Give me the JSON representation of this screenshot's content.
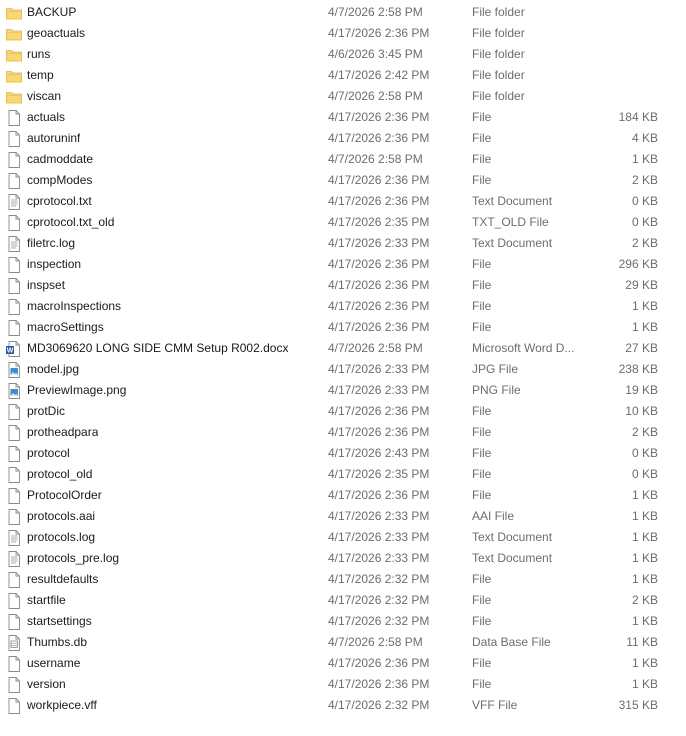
{
  "files": [
    {
      "name": "BACKUP",
      "date": "4/7/2026 2:58 PM",
      "type": "File folder",
      "size": "",
      "icon": "folder-icon"
    },
    {
      "name": "geoactuals",
      "date": "4/17/2026 2:36 PM",
      "type": "File folder",
      "size": "",
      "icon": "folder-icon"
    },
    {
      "name": "runs",
      "date": "4/6/2026 3:45 PM",
      "type": "File folder",
      "size": "",
      "icon": "folder-icon"
    },
    {
      "name": "temp",
      "date": "4/17/2026 2:42 PM",
      "type": "File folder",
      "size": "",
      "icon": "folder-icon"
    },
    {
      "name": "viscan",
      "date": "4/7/2026 2:58 PM",
      "type": "File folder",
      "size": "",
      "icon": "folder-icon"
    },
    {
      "name": "actuals",
      "date": "4/17/2026 2:36 PM",
      "type": "File",
      "size": "184 KB",
      "icon": "file-icon"
    },
    {
      "name": "autoruninf",
      "date": "4/17/2026 2:36 PM",
      "type": "File",
      "size": "4 KB",
      "icon": "file-icon"
    },
    {
      "name": "cadmoddate",
      "date": "4/7/2026 2:58 PM",
      "type": "File",
      "size": "1 KB",
      "icon": "file-icon"
    },
    {
      "name": "compModes",
      "date": "4/17/2026 2:36 PM",
      "type": "File",
      "size": "2 KB",
      "icon": "file-icon"
    },
    {
      "name": "cprotocol.txt",
      "date": "4/17/2026 2:36 PM",
      "type": "Text Document",
      "size": "0 KB",
      "icon": "text-document-icon"
    },
    {
      "name": "cprotocol.txt_old",
      "date": "4/17/2026 2:35 PM",
      "type": "TXT_OLD File",
      "size": "0 KB",
      "icon": "file-icon"
    },
    {
      "name": "filetrc.log",
      "date": "4/17/2026 2:33 PM",
      "type": "Text Document",
      "size": "2 KB",
      "icon": "text-document-icon"
    },
    {
      "name": "inspection",
      "date": "4/17/2026 2:36 PM",
      "type": "File",
      "size": "296 KB",
      "icon": "file-icon"
    },
    {
      "name": "inspset",
      "date": "4/17/2026 2:36 PM",
      "type": "File",
      "size": "29 KB",
      "icon": "file-icon"
    },
    {
      "name": "macroInspections",
      "date": "4/17/2026 2:36 PM",
      "type": "File",
      "size": "1 KB",
      "icon": "file-icon"
    },
    {
      "name": "macroSettings",
      "date": "4/17/2026 2:36 PM",
      "type": "File",
      "size": "1 KB",
      "icon": "file-icon"
    },
    {
      "name": "MD3069620 LONG SIDE CMM Setup R002.docx",
      "date": "4/7/2026 2:58 PM",
      "type": "Microsoft Word D...",
      "size": "27 KB",
      "icon": "word-document-icon"
    },
    {
      "name": "model.jpg",
      "date": "4/17/2026 2:33 PM",
      "type": "JPG File",
      "size": "238 KB",
      "icon": "image-file-icon"
    },
    {
      "name": "PreviewImage.png",
      "date": "4/17/2026 2:33 PM",
      "type": "PNG File",
      "size": "19 KB",
      "icon": "image-file-icon"
    },
    {
      "name": "protDic",
      "date": "4/17/2026 2:36 PM",
      "type": "File",
      "size": "10 KB",
      "icon": "file-icon"
    },
    {
      "name": "protheadpara",
      "date": "4/17/2026 2:36 PM",
      "type": "File",
      "size": "2 KB",
      "icon": "file-icon"
    },
    {
      "name": "protocol",
      "date": "4/17/2026 2:43 PM",
      "type": "File",
      "size": "0 KB",
      "icon": "file-icon"
    },
    {
      "name": "protocol_old",
      "date": "4/17/2026 2:35 PM",
      "type": "File",
      "size": "0 KB",
      "icon": "file-icon"
    },
    {
      "name": "ProtocolOrder",
      "date": "4/17/2026 2:36 PM",
      "type": "File",
      "size": "1 KB",
      "icon": "file-icon"
    },
    {
      "name": "protocols.aai",
      "date": "4/17/2026 2:33 PM",
      "type": "AAI File",
      "size": "1 KB",
      "icon": "file-icon"
    },
    {
      "name": "protocols.log",
      "date": "4/17/2026 2:33 PM",
      "type": "Text Document",
      "size": "1 KB",
      "icon": "text-document-icon"
    },
    {
      "name": "protocols_pre.log",
      "date": "4/17/2026 2:33 PM",
      "type": "Text Document",
      "size": "1 KB",
      "icon": "text-document-icon"
    },
    {
      "name": "resultdefaults",
      "date": "4/17/2026 2:32 PM",
      "type": "File",
      "size": "1 KB",
      "icon": "file-icon"
    },
    {
      "name": "startfile",
      "date": "4/17/2026 2:32 PM",
      "type": "File",
      "size": "2 KB",
      "icon": "file-icon"
    },
    {
      "name": "startsettings",
      "date": "4/17/2026 2:32 PM",
      "type": "File",
      "size": "1 KB",
      "icon": "file-icon"
    },
    {
      "name": "Thumbs.db",
      "date": "4/7/2026 2:58 PM",
      "type": "Data Base File",
      "size": "11 KB",
      "icon": "database-file-icon"
    },
    {
      "name": "username",
      "date": "4/17/2026 2:36 PM",
      "type": "File",
      "size": "1 KB",
      "icon": "file-icon"
    },
    {
      "name": "version",
      "date": "4/17/2026 2:36 PM",
      "type": "File",
      "size": "1 KB",
      "icon": "file-icon"
    },
    {
      "name": "workpiece.vff",
      "date": "4/17/2026 2:32 PM",
      "type": "VFF File",
      "size": "315 KB",
      "icon": "file-icon"
    }
  ],
  "colors": {
    "folder": "#f8d775",
    "folder_dark": "#e0b344",
    "word": "#2b579a",
    "image": "#3a8fd6",
    "text_primary": "#1a1a1a",
    "text_secondary": "#6d6d6d"
  }
}
